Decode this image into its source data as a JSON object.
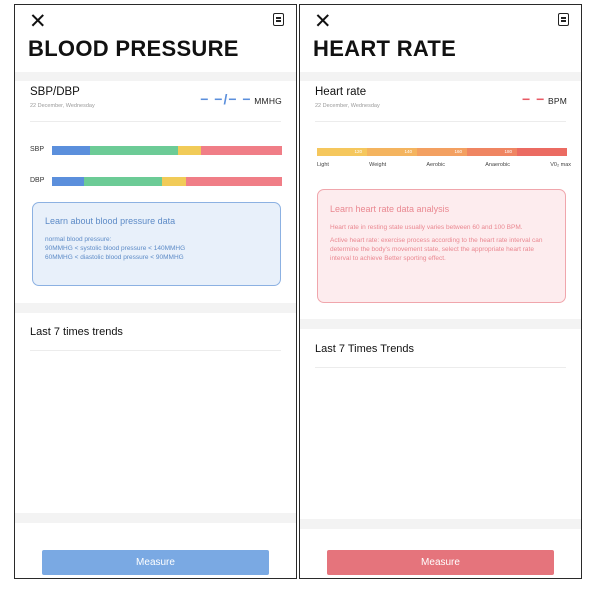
{
  "colors": {
    "bp_blue": "#5b8fdc",
    "bp_green": "#6ccb96",
    "bp_yellow": "#f1cb58",
    "bp_pink": "#f07e87",
    "bp_info_bg": "#e8f0fa",
    "bp_info_border": "#8cb1e2",
    "bp_info_text": "#5d8bc7",
    "bp_measure": "#7aa9e3",
    "hr_red": "#e85a65",
    "hr_info_bg": "#fdecee",
    "hr_info_border": "#f0a6ac",
    "hr_info_text": "#ea8891",
    "hr_measure": "#e5747c"
  },
  "bp": {
    "close_icon": "close-icon",
    "doc_icon": "document-icon",
    "title": "BLOOD PRESSURE",
    "label": "SBP/DBP",
    "date": "22 December, Wednesday",
    "value": "− −/− −",
    "unit": "MMHG",
    "sbp_label": "SBP",
    "dbp_label": "DBP",
    "sbp_segments": [
      16.7,
      37.9,
      10.2,
      35.2
    ],
    "dbp_segments": [
      14.0,
      34.0,
      10.2,
      41.8
    ],
    "info_title": "Learn about blood pressure data",
    "info_lines": [
      "normal blood pressure:",
      "90MMHG < systolic blood pressure < 140MMHG",
      "60MMHG < diastolic blood pressure < 90MMHG"
    ],
    "trend_title": "Last 7 times trends",
    "measure_label": "Measure"
  },
  "hr": {
    "close_icon": "close-icon",
    "doc_icon": "document-icon",
    "title": "HEART RATE",
    "label": "Heart rate",
    "date": "22 December, Wednesday",
    "value": "− −",
    "unit": "BPM",
    "scale_ticks": [
      "120",
      "140",
      "160",
      "180",
      ""
    ],
    "scale_colors": [
      "#f5c75d",
      "#f4b45f",
      "#f3a061",
      "#ef8562",
      "#eb6b62"
    ],
    "zones": [
      "Light",
      "Weight",
      "Aerobic",
      "Anaerobic",
      "V0₂ max"
    ],
    "info_title": "Learn heart rate data analysis",
    "info_para1": "Heart rate in resting state usually varies between 60 and 100 BPM.",
    "info_para2": "Active heart rate: exercise process according to the heart rate interval can determine the body's movement state, select the appropriate heart rate interval to achieve Better sporting effect.",
    "trend_title": "Last 7 Times Trends",
    "measure_label": "Measure"
  }
}
